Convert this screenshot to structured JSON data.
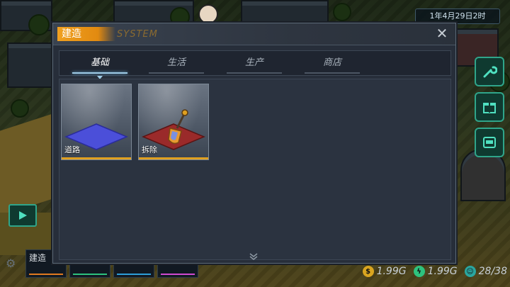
{
  "hud": {
    "date": "1年4月29日2时"
  },
  "dialog": {
    "title": "建造",
    "subtitle": "SYSTEM",
    "close_icon": "close-icon",
    "tabs": [
      {
        "label": "基础",
        "active": true
      },
      {
        "label": "生活",
        "active": false
      },
      {
        "label": "生产",
        "active": false
      },
      {
        "label": "商店",
        "active": false
      }
    ],
    "items": [
      {
        "label": "道路",
        "icon": "road-tile-icon",
        "tile_color": "#4b4fd9"
      },
      {
        "label": "拆除",
        "icon": "shovel-icon",
        "tile_color": "#9a2a2a"
      }
    ],
    "more_icon": "double-chevron-down-icon"
  },
  "bottom_bar": {
    "tab_label": "建造",
    "tab_colors": [
      "#e07a20",
      "#2ec27e",
      "#2e9ed8",
      "#d04ad0"
    ]
  },
  "resources": [
    {
      "icon": "coin-icon",
      "value": "1.99G",
      "color": "#d9a520"
    },
    {
      "icon": "energy-icon",
      "value": "1.99G",
      "color": "#2ec27e"
    },
    {
      "icon": "population-icon",
      "value": "28/38",
      "color": "#2aa6a0"
    }
  ],
  "side_buttons": [
    "wrench-icon",
    "gift-icon",
    "machine-icon"
  ]
}
